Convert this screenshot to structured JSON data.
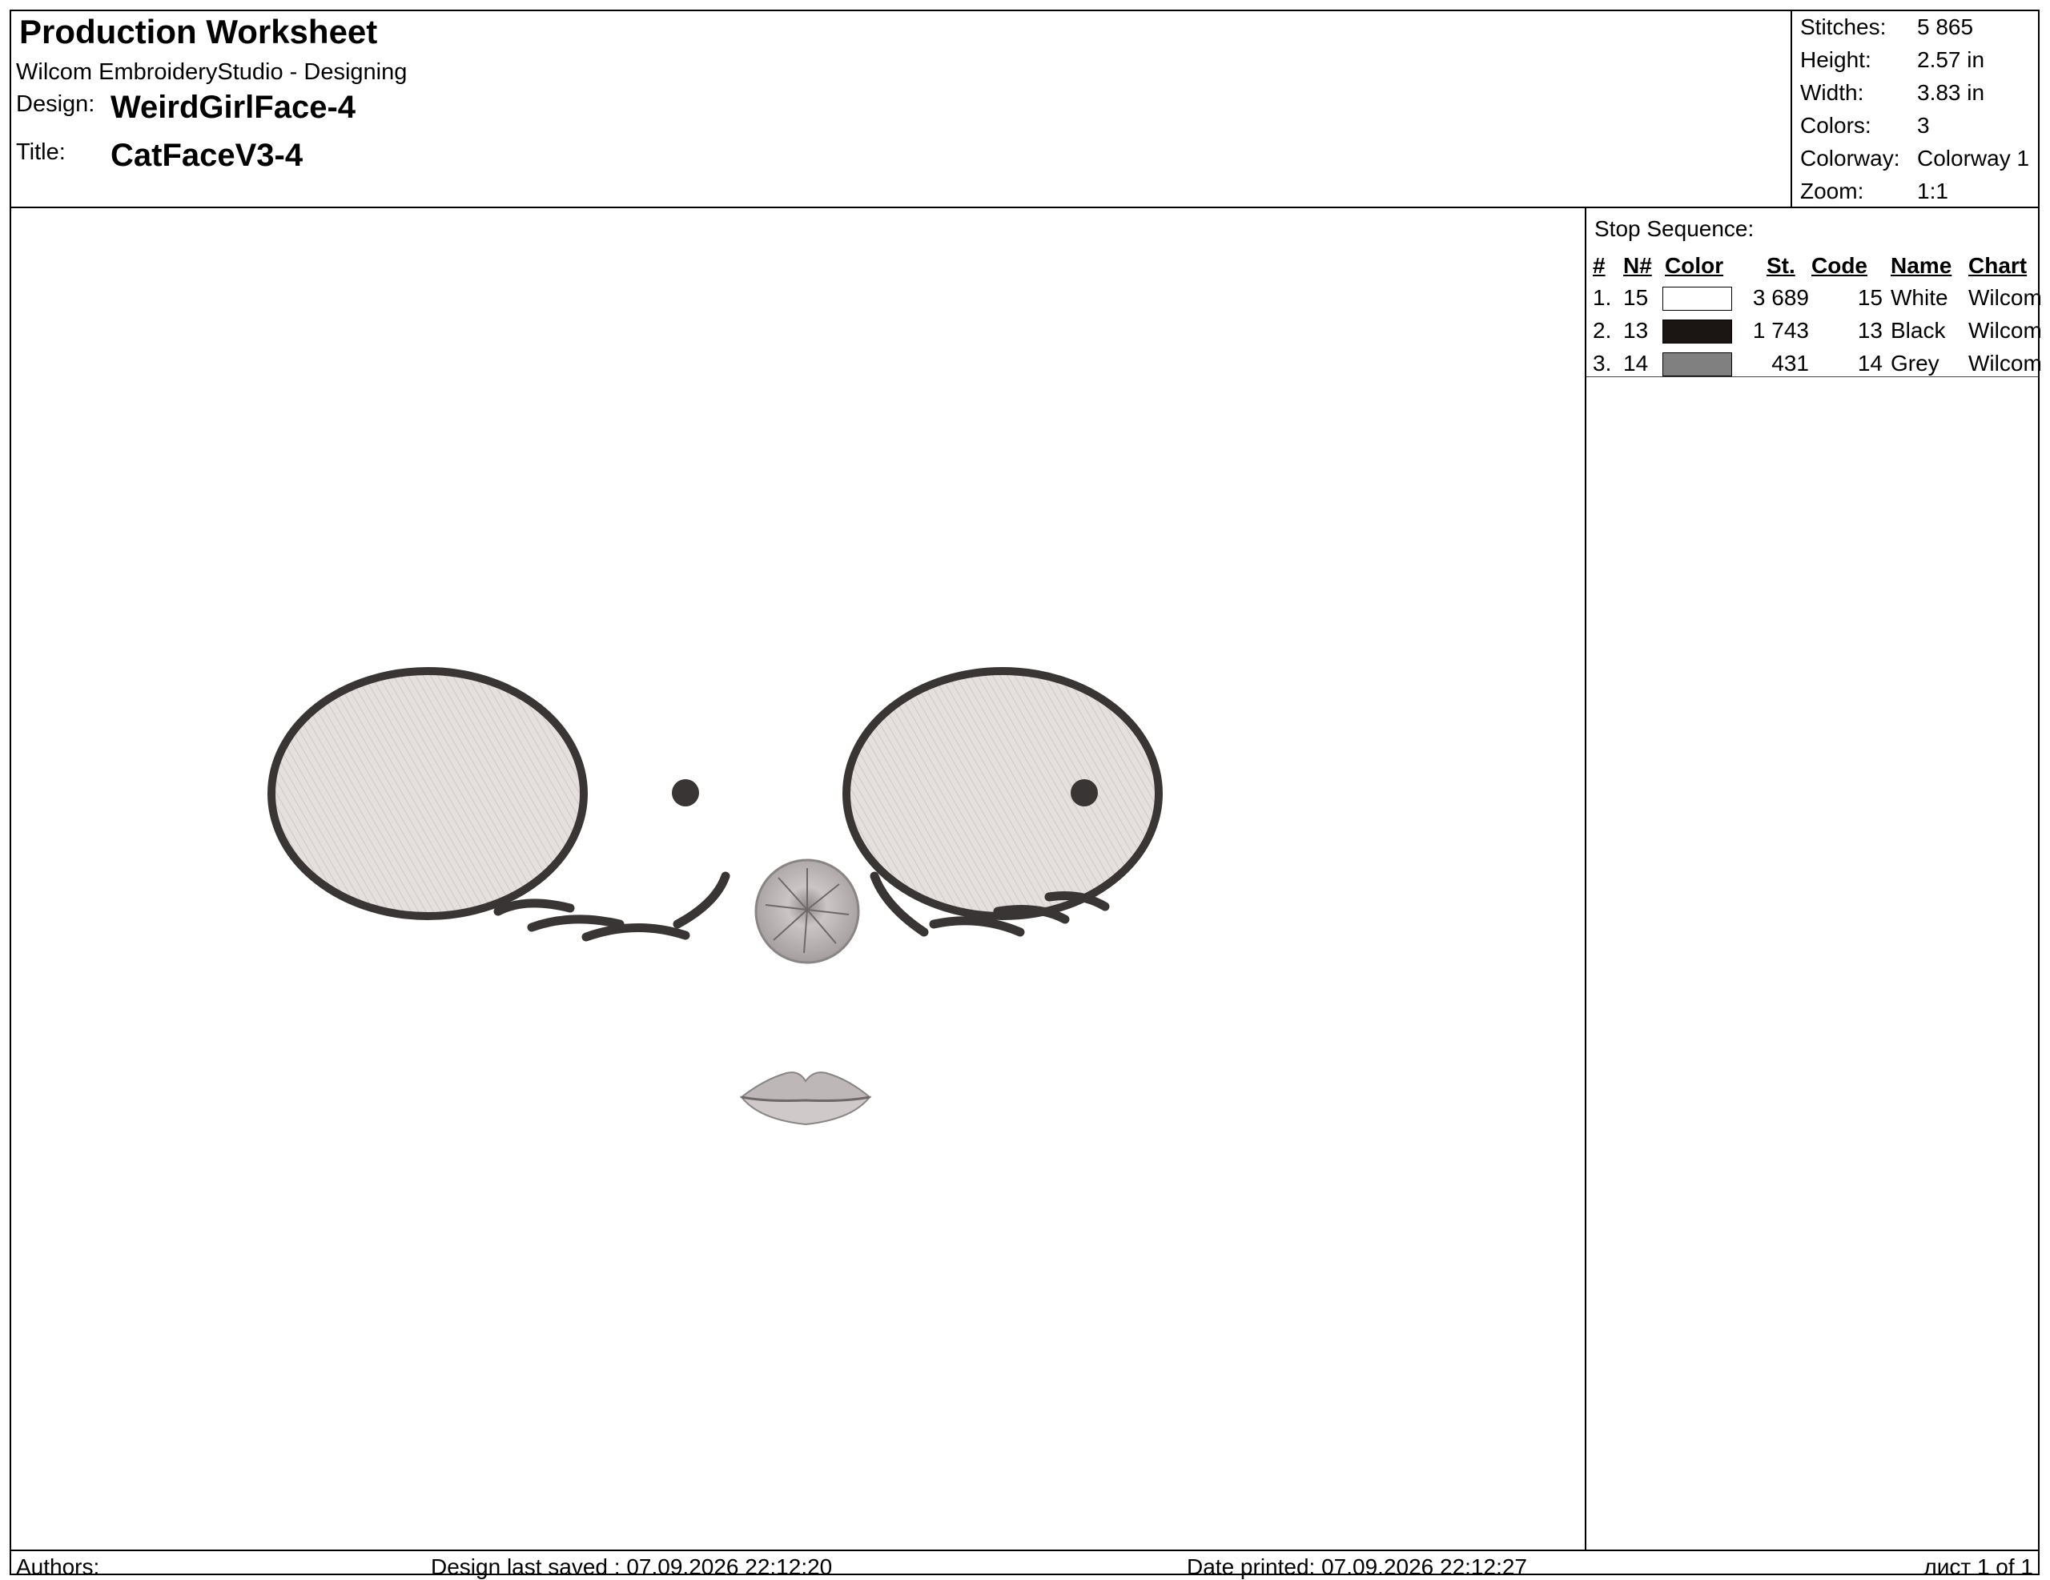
{
  "header": {
    "title": "Production Worksheet",
    "app": "Wilcom EmbroideryStudio - Designing",
    "design_label": "Design:",
    "design_value": "WeirdGirlFace-4",
    "title_label": "Title:",
    "title_value": "CatFaceV3-4"
  },
  "stats": [
    {
      "label": "Stitches:",
      "value": "5 865"
    },
    {
      "label": "Height:",
      "value": "2.57 in"
    },
    {
      "label": "Width:",
      "value": "3.83 in"
    },
    {
      "label": "Colors:",
      "value": "3"
    },
    {
      "label": "Colorway:",
      "value": "Colorway 1"
    },
    {
      "label": "Zoom:",
      "value": "1:1"
    }
  ],
  "stop_sequence": {
    "title": "Stop Sequence:",
    "headers": [
      "#",
      "N#",
      "Color",
      "St.",
      "Code",
      "Name",
      "Chart"
    ],
    "rows": [
      {
        "num": "1.",
        "n": "15",
        "color": "#ffffff",
        "st": "3 689",
        "code": "15",
        "name": "White",
        "chart": "Wilcom"
      },
      {
        "num": "2.",
        "n": "13",
        "color": "#1b1513",
        "st": "1 743",
        "code": "13",
        "name": "Black",
        "chart": "Wilcom"
      },
      {
        "num": "3.",
        "n": "14",
        "color": "#808080",
        "st": "431",
        "code": "14",
        "name": "Grey",
        "chart": "Wilcom"
      }
    ]
  },
  "footer": {
    "authors": "Authors:",
    "saved": "Design last saved : 07.09.2026 22:12:20",
    "printed": "Date printed: 07.09.2026 22:12:27",
    "page": "лист 1 of 1"
  },
  "colors": {
    "outline": "#3a3535",
    "fill": "#e5dfde",
    "nose": "#c4bebe",
    "lips": "#bdb7b7"
  }
}
